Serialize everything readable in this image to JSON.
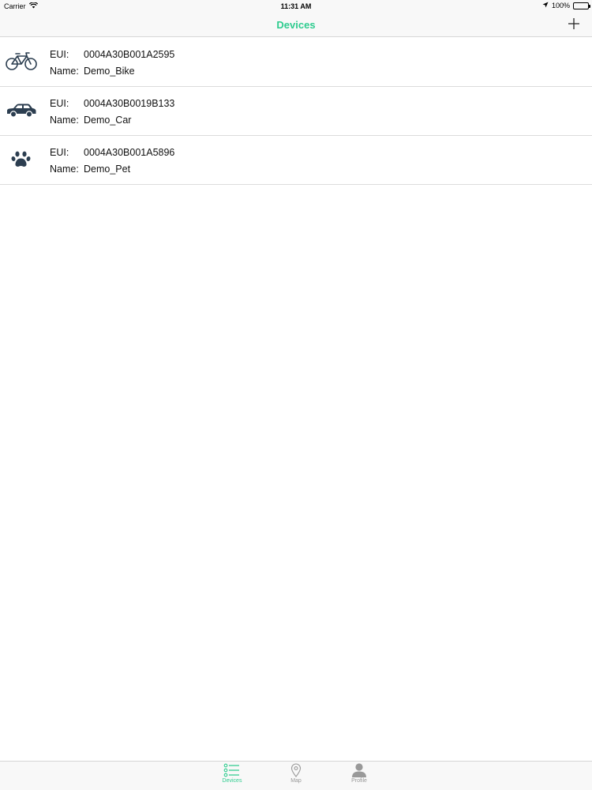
{
  "status_bar": {
    "carrier": "Carrier",
    "time": "11:31 AM",
    "battery": "100%"
  },
  "nav": {
    "title": "Devices"
  },
  "devices": [
    {
      "icon": "bicycle-icon",
      "eui_label": "EUI:",
      "eui": "0004A30B001A2595",
      "name_label": "Name:",
      "name": "Demo_Bike"
    },
    {
      "icon": "car-icon",
      "eui_label": "EUI:",
      "eui": "0004A30B0019B133",
      "name_label": "Name:",
      "name": "Demo_Car"
    },
    {
      "icon": "paw-icon",
      "eui_label": "EUI:",
      "eui": "0004A30B001A5896",
      "name_label": "Name:",
      "name": "Demo_Pet"
    }
  ],
  "tabs": [
    {
      "label": "Devices",
      "icon": "list-icon",
      "active": true
    },
    {
      "label": "Map",
      "icon": "map-pin-icon",
      "active": false
    },
    {
      "label": "Profile",
      "icon": "person-icon",
      "active": false
    }
  ],
  "colors": {
    "accent": "#2ecc8f",
    "icon_dark": "#2c3e50",
    "inactive": "#999999"
  }
}
